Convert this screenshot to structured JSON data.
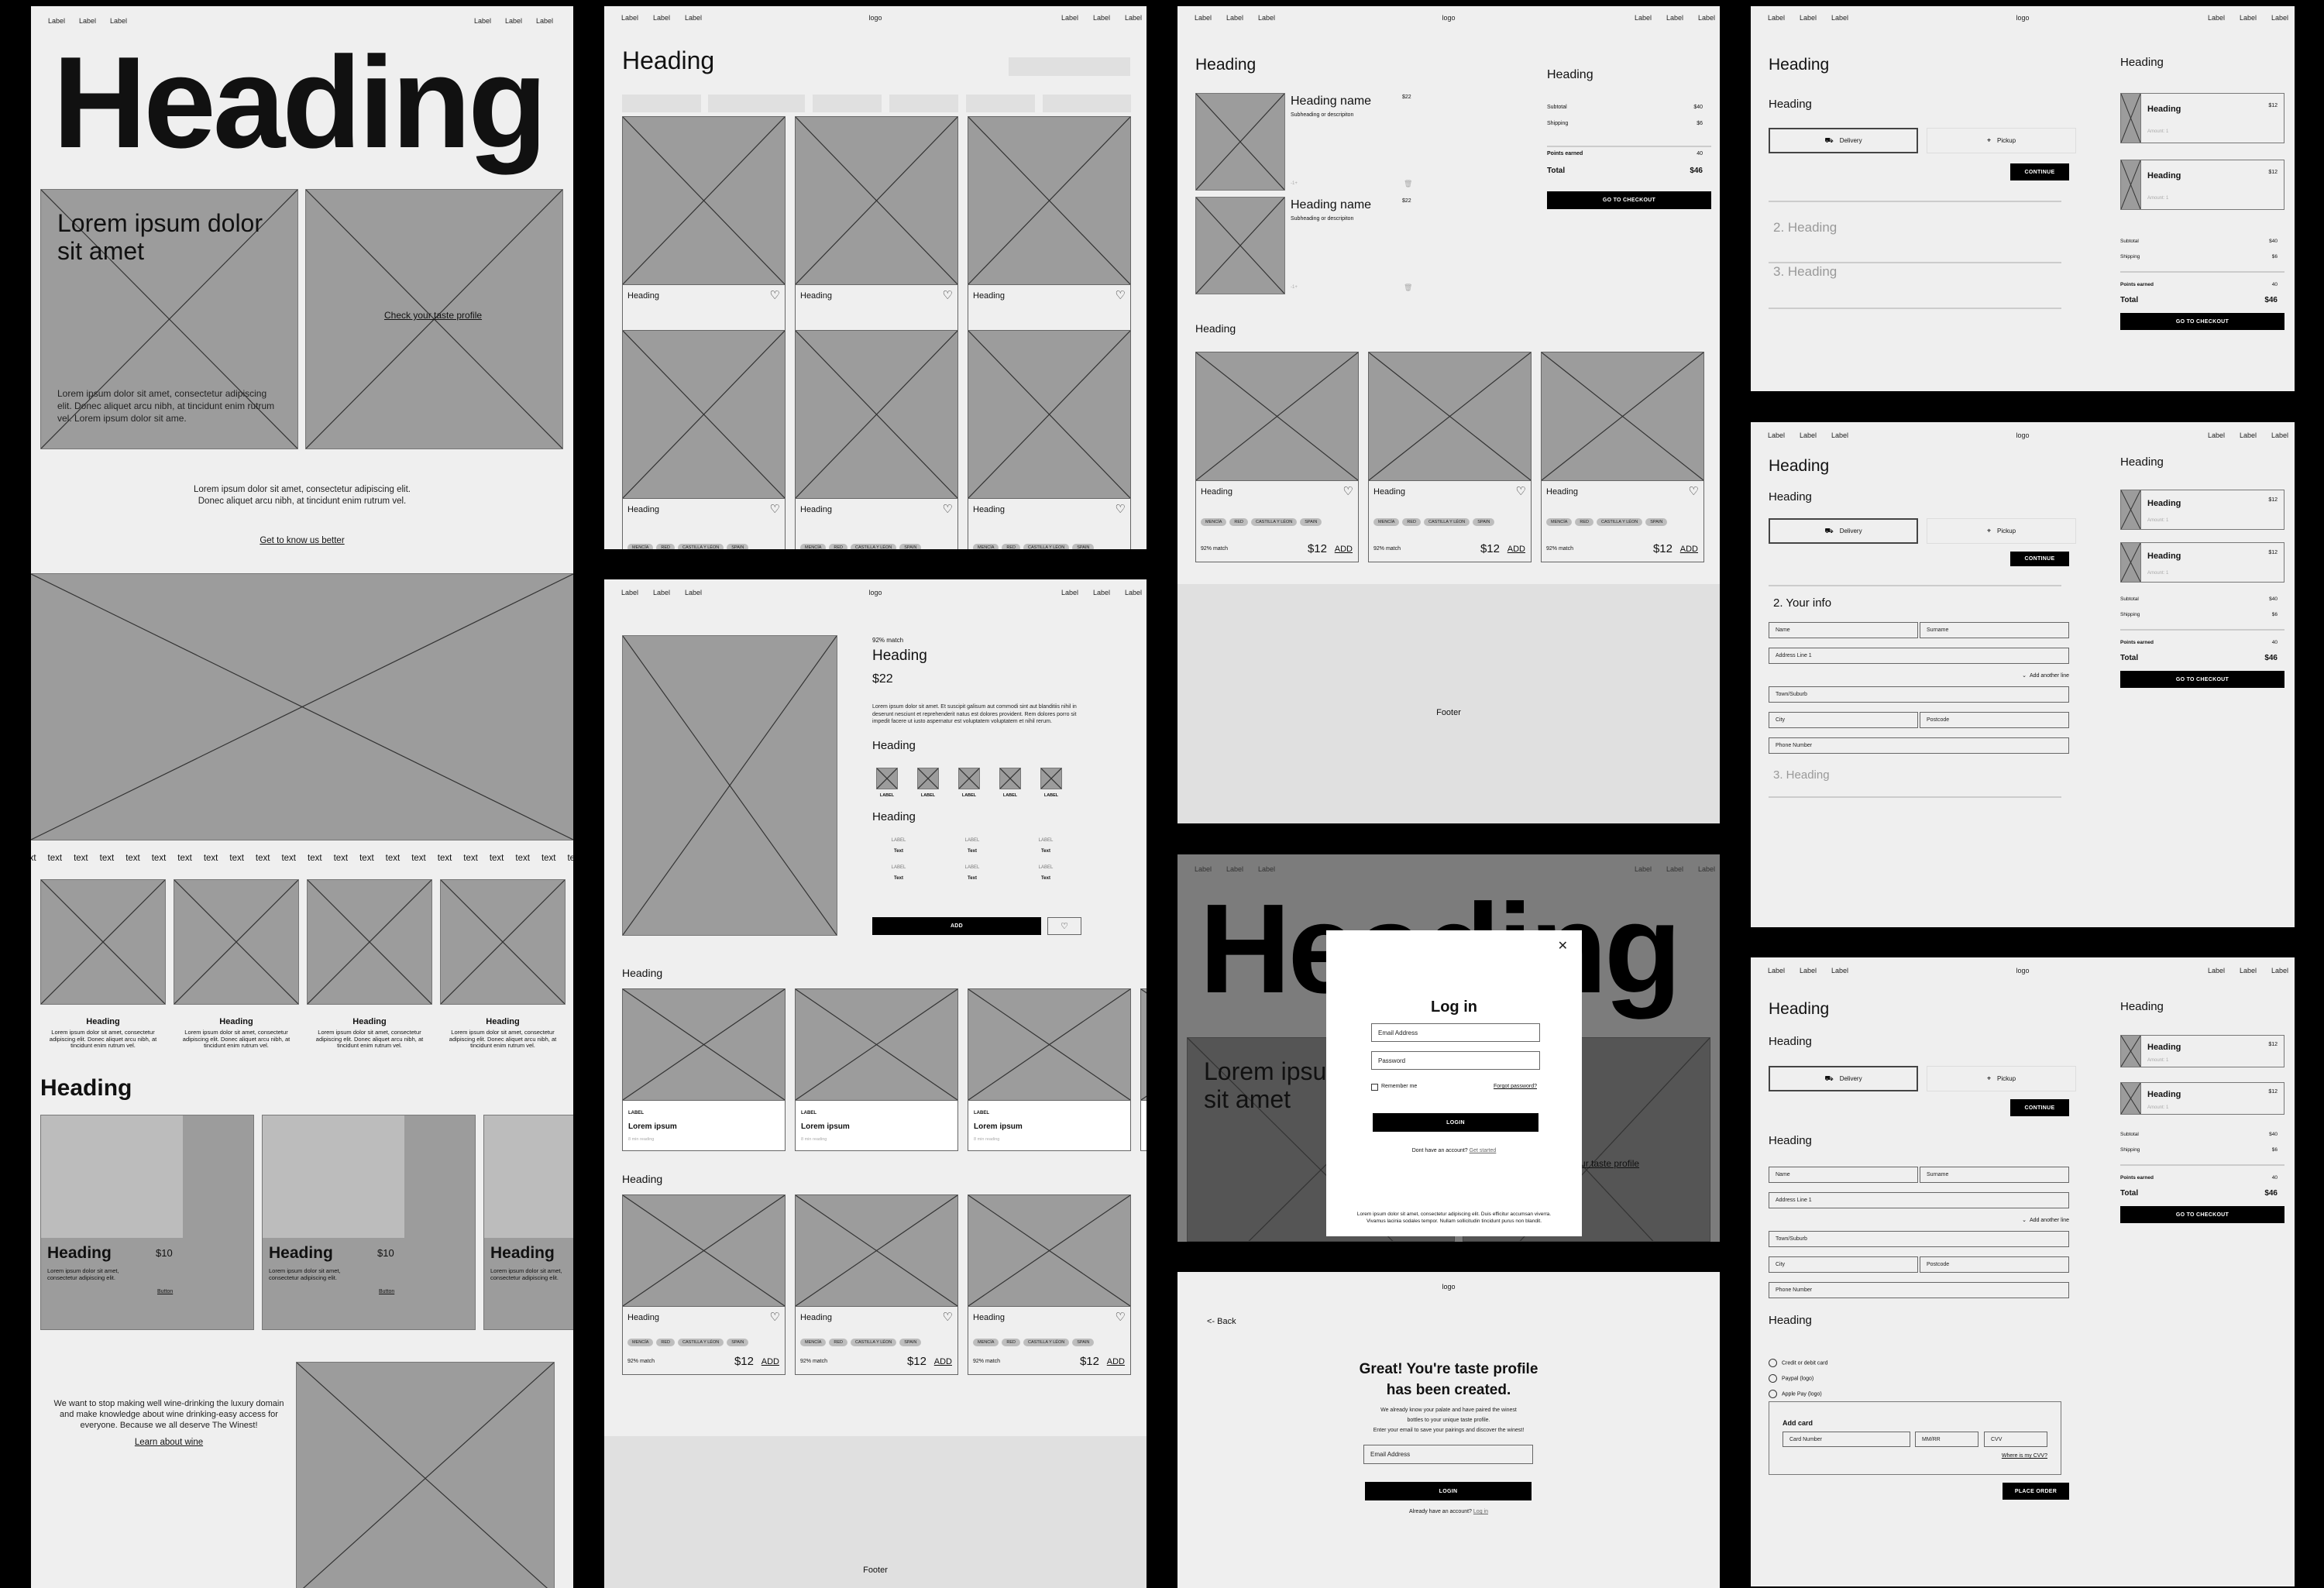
{
  "nav": {
    "left": [
      "Label",
      "Label",
      "Label"
    ],
    "right": [
      "Label",
      "Label",
      "Label"
    ],
    "logo": "logo"
  },
  "home": {
    "hero_heading": "Heading",
    "hero_card_title": "Lorem ipsum dolor sit amet",
    "hero_card_body": "Lorem ipsum dolor sit amet, consectetur adipiscing elit. Donec aliquet arcu nibh, at tincidunt enim rutrum vel. Lorem ipsum dolor sit ame.",
    "taste_link": "Check your taste profile",
    "intro_text": "Lorem ipsum dolor sit amet, consectetur adipiscing elit. Donec aliquet arcu nibh, at tincidunt enim rutrum vel.",
    "intro_link": "Get to know us better",
    "ticker_word": "text",
    "features": [
      {
        "heading": "Heading",
        "body": "Lorem ipsum dolor sit amet, consectetur adipiscing elit. Donec aliquet arcu nibh, at tincidunt enim rutrum vel."
      },
      {
        "heading": "Heading",
        "body": "Lorem ipsum dolor sit amet, consectetur adipiscing elit. Donec aliquet arcu nibh, at tincidunt enim rutrum vel."
      },
      {
        "heading": "Heading",
        "body": "Lorem ipsum dolor sit amet, consectetur adipiscing elit. Donec aliquet arcu nibh, at tincidunt enim rutrum vel."
      },
      {
        "heading": "Heading",
        "body": "Lorem ipsum dolor sit amet, consectetur adipiscing elit. Donec aliquet arcu nibh, at tincidunt enim rutrum vel."
      }
    ],
    "section_heading": "Heading",
    "promo_cards": [
      {
        "heading": "Heading",
        "price": "$10",
        "body": "Lorem ipsum dolor sit amet, consectetur adipiscing elit.",
        "button": "Button"
      },
      {
        "heading": "Heading",
        "price": "$10",
        "body": "Lorem ipsum dolor sit amet, consectetur adipiscing elit.",
        "button": "Button"
      },
      {
        "heading": "Heading",
        "price": "",
        "body": "Lorem ipsum dolor sit amet, consectetur adipiscing elit.",
        "button": ""
      }
    ],
    "mission_text": "We want to stop making well wine-drinking the luxury domain and make knowledge about wine drinking-easy access for everyone. Because we all deserve The Winest!",
    "mission_link": "Learn about wine"
  },
  "product": {
    "heading": "Heading",
    "tags": [
      "MENCÍA",
      "RED",
      "CASTILLA Y LÉON",
      "SPAIN"
    ],
    "match": "92% match",
    "price": "$12",
    "add": "ADD"
  },
  "listing": {
    "heading": "Heading"
  },
  "detail": {
    "match": "92% match",
    "heading": "Heading",
    "price": "$22",
    "description": "Lorem ipsum dolor sit amet. Et suscipit galisum aut commodi sint aut blanditiis nihil in deserunt nesciunt et reprehenderit natus est dolores provident. Rem dolores porro sit impedit facere ut iusto aspernatur est voluptatem voluptatem et nihil rerum.",
    "swatch_heading": "Heading",
    "swatches": [
      "LABEL",
      "LABEL",
      "LABEL",
      "LABEL",
      "LABEL"
    ],
    "specs_heading": "Heading",
    "specs": [
      {
        "label": "LABEL",
        "value": "Text"
      },
      {
        "label": "LABEL",
        "value": "Text"
      },
      {
        "label": "LABEL",
        "value": "Text"
      },
      {
        "label": "LABEL",
        "value": "Text"
      },
      {
        "label": "LABEL",
        "value": "Text"
      },
      {
        "label": "LABEL",
        "value": "Text"
      }
    ],
    "add_button": "ADD",
    "articles_heading": "Heading",
    "articles": [
      {
        "label": "LABEL",
        "title": "Lorem ipsum",
        "meta": "8 min reading"
      },
      {
        "label": "LABEL",
        "title": "Lorem ipsum",
        "meta": "8 min reading"
      },
      {
        "label": "LABEL",
        "title": "Lorem ipsum",
        "meta": "8 min reading"
      }
    ],
    "related_heading": "Heading",
    "footer": "Footer"
  },
  "cart": {
    "heading": "Heading",
    "items": [
      {
        "name": "Heading name",
        "desc": "Subheading or descripiton",
        "price": "$22",
        "qty": "-1+"
      },
      {
        "name": "Heading name",
        "desc": "Subheading or descripiton",
        "price": "$22",
        "qty": "-1+"
      }
    ],
    "summary_heading": "Heading",
    "subtotal_label": "Subtotal",
    "subtotal": "$40",
    "shipping_label": "Shipping",
    "shipping": "$6",
    "points_label": "Points earned",
    "points": "40",
    "total_label": "Total",
    "total": "$46",
    "checkout_button": "GO TO CHECKOUT",
    "recommended_heading": "Heading",
    "footer": "Footer"
  },
  "login": {
    "title": "Log in",
    "email_placeholder": "Email Address",
    "password_placeholder": "Password",
    "remember": "Remember me",
    "forgot": "Forgot password?",
    "button": "LOGIN",
    "no_account": "Dont have an account?",
    "get_started": "Get started",
    "legal": "Lorem ipsum dolor sit amet, consectetur adipiscing elit. Duis efficitur accumsan viverra. Vivamus lacinia sodales tempor. Nullam sollicitudin tincidunt purus non blandit.",
    "bg_heading": "Heading",
    "bg_card_title": "Lorem ipsum dolor sit amet",
    "bg_link": "Check your taste profile"
  },
  "taste": {
    "back": "<- Back",
    "title_line1": "Great! You're taste profile",
    "title_line2": "has been created.",
    "body_line1": "We already know your palate and have paired the winest",
    "body_line2": "bottles to your unique taste profile.",
    "body_line3": "Enter your email to save your pairings and discover the winest!",
    "email_placeholder": "Email Address",
    "button": "LOGIN",
    "have_account": "Already have an account?",
    "login_link": "Log in"
  },
  "checkout": {
    "heading": "Heading",
    "sub_heading": "Heading",
    "delivery": "Delivery",
    "pickup": "Pickup",
    "continue": "CONTINUE",
    "step2_collapsed": "2. Heading",
    "step3_collapsed": "3. Heading",
    "step2_open": "2. Your info",
    "info_heading": "Heading",
    "fields": {
      "name": "Name",
      "surname": "Surname",
      "address1": "Address Line 1",
      "add_line": "Add another line",
      "town": "Town/Suburb",
      "city": "City",
      "postcode": "Postcode",
      "phone": "Phone Number"
    },
    "payment_heading": "Heading",
    "payment_options": [
      "Credit or debit card",
      "Paypal (logo)",
      "Apple Pay (logo)"
    ],
    "add_card": "Add card",
    "card_number": "Card Number",
    "expiry": "MM/RR",
    "cvv": "CVV",
    "cvv_help": "Where is my CVV?",
    "place_order": "PLACE ORDER",
    "summary_heading": "Heading",
    "summary_items": [
      {
        "name": "Heading",
        "price": "$12",
        "amount": "Amount: 1"
      },
      {
        "name": "Heading",
        "price": "$12",
        "amount": "Amount: 1"
      }
    ],
    "subtotal_label": "Subtotal",
    "subtotal": "$40",
    "shipping_label": "Shipping",
    "shipping": "$6",
    "points_label": "Points earned",
    "points": "40",
    "total_label": "Total",
    "total": "$46",
    "checkout_button": "GO TO CHECKOUT"
  }
}
